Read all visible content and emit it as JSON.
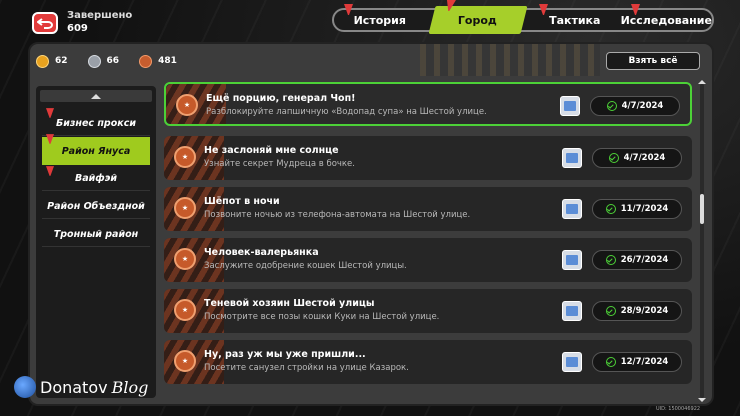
{
  "header": {
    "completed_label": "Завершено",
    "completed_count": "609"
  },
  "tabs": [
    {
      "label": "История",
      "alert": true,
      "active": false
    },
    {
      "label": "Город",
      "alert": true,
      "active": true
    },
    {
      "label": "Тактика",
      "alert": true,
      "active": false
    },
    {
      "label": "Исследование",
      "alert": true,
      "active": false
    }
  ],
  "resources": {
    "gold": "62",
    "silver": "66",
    "bronze": "481"
  },
  "take_all_label": "Взять всё",
  "sidebar": {
    "items": [
      {
        "label": "Бизнес прокси",
        "alert": true,
        "active": false
      },
      {
        "label": "Район Януса",
        "alert": true,
        "active": true
      },
      {
        "label": "Вайфэй",
        "alert": true,
        "active": false
      },
      {
        "label": "Район Объездной",
        "alert": false,
        "active": false
      },
      {
        "label": "Тронный район",
        "alert": false,
        "active": false
      }
    ]
  },
  "quests": [
    {
      "title": "Ещё порцию, генерал Чоп!",
      "subtitle": "Разблокируйте лапшичную «Водопад супа» на Шестой улице.",
      "date": "4/7/2024",
      "selected": true
    },
    {
      "title": "Не заслоняй мне солнце",
      "subtitle": "Узнайте секрет Мудреца в бочке.",
      "date": "4/7/2024",
      "selected": false
    },
    {
      "title": "Шёпот в ночи",
      "subtitle": "Позвоните ночью из телефона-автомата на Шестой улице.",
      "date": "11/7/2024",
      "selected": false
    },
    {
      "title": "Человек-валерьянка",
      "subtitle": "Заслужите одобрение кошек Шестой улицы.",
      "date": "26/7/2024",
      "selected": false
    },
    {
      "title": "Теневой хозяин Шестой улицы",
      "subtitle": "Посмотрите все позы кошки Куки на Шестой улице.",
      "date": "28/9/2024",
      "selected": false
    },
    {
      "title": "Ну, раз уж мы уже пришли...",
      "subtitle": "Посетите санузел стройки на улице Казарок.",
      "date": "12/7/2024",
      "selected": false
    }
  ],
  "watermark": {
    "brand": "Donatov",
    "suffix": "Blog"
  },
  "uid": "UID: 1500046922"
}
